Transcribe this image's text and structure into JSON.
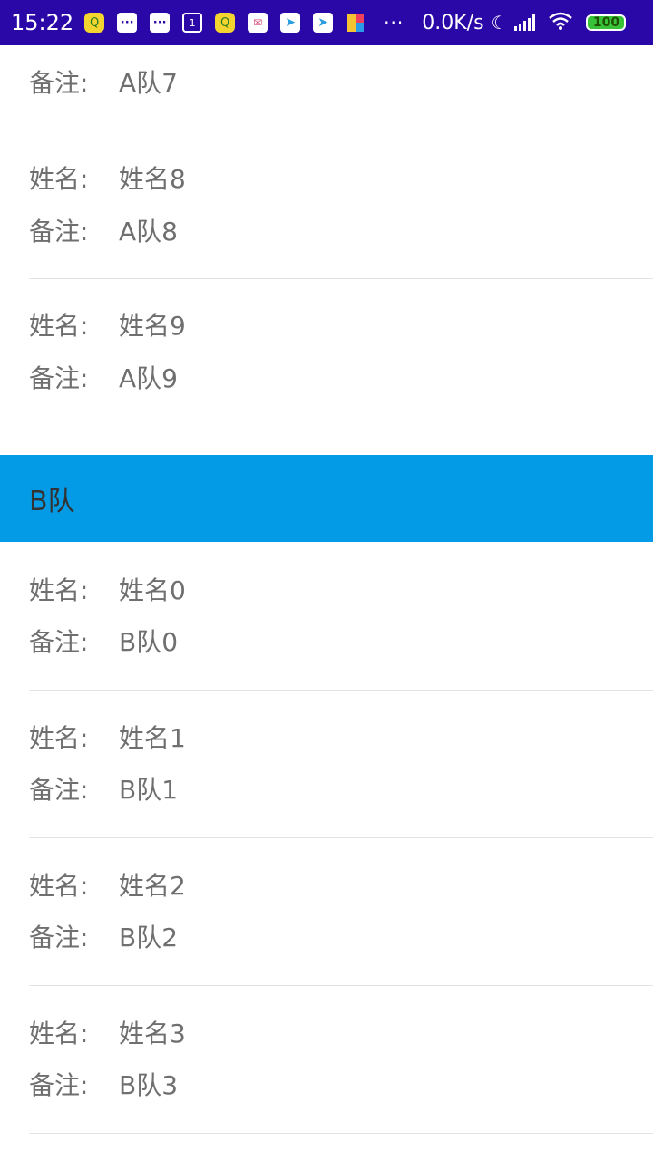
{
  "status_bar": {
    "time": "15:22",
    "notifications": [
      {
        "icon": "qq-icon",
        "glyph": "Q"
      },
      {
        "icon": "message-icon",
        "glyph": "···"
      },
      {
        "icon": "message-icon",
        "glyph": "···"
      },
      {
        "icon": "calendar-icon",
        "glyph": "1"
      },
      {
        "icon": "qq-icon",
        "glyph": "Q"
      },
      {
        "icon": "mail-icon",
        "glyph": "✉"
      },
      {
        "icon": "telegram-icon",
        "glyph": "➤"
      },
      {
        "icon": "telegram-icon",
        "glyph": "➤"
      },
      {
        "icon": "kite-app-icon",
        "glyph": ""
      }
    ],
    "more": "···",
    "network_speed": "0.0K/s",
    "battery_level": "100"
  },
  "list": {
    "a7": {
      "remark_label": "备注:",
      "remark_value": "A队7"
    },
    "a8": {
      "name_label": "姓名:",
      "name_value": "姓名8",
      "remark_label": "备注:",
      "remark_value": "A队8"
    },
    "a9": {
      "name_label": "姓名:",
      "name_value": "姓名9",
      "remark_label": "备注:",
      "remark_value": "A队9"
    },
    "section_b": "B队",
    "b0": {
      "name_label": "姓名:",
      "name_value": "姓名0",
      "remark_label": "备注:",
      "remark_value": "B队0"
    },
    "b1": {
      "name_label": "姓名:",
      "name_value": "姓名1",
      "remark_label": "备注:",
      "remark_value": "B队1"
    },
    "b2": {
      "name_label": "姓名:",
      "name_value": "姓名2",
      "remark_label": "备注:",
      "remark_value": "B队2"
    },
    "b3": {
      "name_label": "姓名:",
      "name_value": "姓名3",
      "remark_label": "备注:",
      "remark_value": "B队3"
    }
  },
  "colors": {
    "status_bar": "#2a08a8",
    "section_header": "#039be5",
    "text": "#6f6f6f",
    "divider": "#e3e3e3"
  }
}
